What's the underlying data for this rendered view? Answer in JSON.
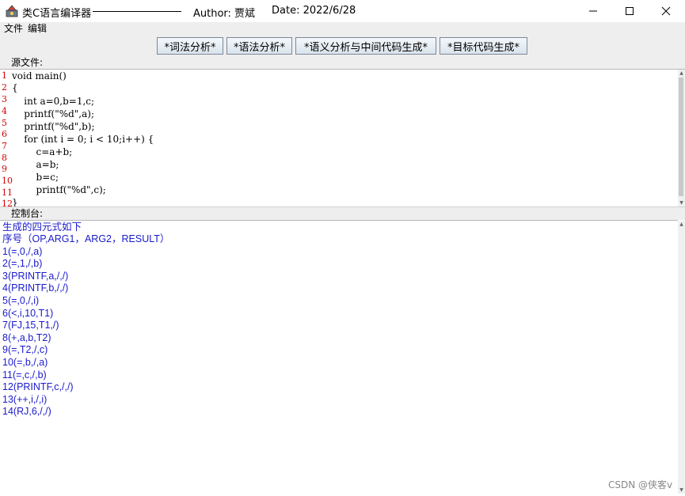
{
  "window": {
    "title": "类C语言编译器",
    "author": "Author: 贾斌",
    "date": "Date: 2022/6/28"
  },
  "menu": [
    "文件",
    "编辑"
  ],
  "toolbar": {
    "buttons": [
      "*词法分析*",
      "*语法分析*",
      "*语义分析与中间代码生成*",
      "*目标代码生成*"
    ]
  },
  "source": {
    "label": "源文件:",
    "lines": [
      "void main()",
      "{",
      "    int a=0,b=1,c;",
      "    printf(\"%d\",a);",
      "    printf(\"%d\",b);",
      "    for (int i = 0; i < 10;i++) {",
      "        c=a+b;",
      "        a=b;",
      "        b=c;",
      "        printf(\"%d\",c);",
      "}"
    ],
    "line_numbers": [
      "1",
      "2",
      "3",
      "4",
      "5",
      "6",
      "7",
      "8",
      "9",
      "10",
      "11",
      "12"
    ]
  },
  "console": {
    "label": "控制台:",
    "lines": [
      "生成的四元式如下",
      "序号（OP,ARG1，ARG2，RESULT）",
      "1(=,0,/,a)",
      "2(=,1,/,b)",
      "3(PRINTF,a,/,/)",
      "4(PRINTF,b,/,/)",
      "5(=,0,/,i)",
      "6(<,i,10,T1)",
      "7(FJ,15,T1,/)",
      "8(+,a,b,T2)",
      "9(=,T2,/,c)",
      "10(=,b,/,a)",
      "11(=,c,/,b)",
      "12(PRINTF,c,/,/)",
      "13(++,i,/,i)",
      "14(RJ,6,/,/)"
    ]
  },
  "watermark": "CSDN @侠客v",
  "colors": {
    "console_text": "#1a1acc",
    "line_number": "#d00000",
    "toolbar_bg": "#eeeeee"
  }
}
